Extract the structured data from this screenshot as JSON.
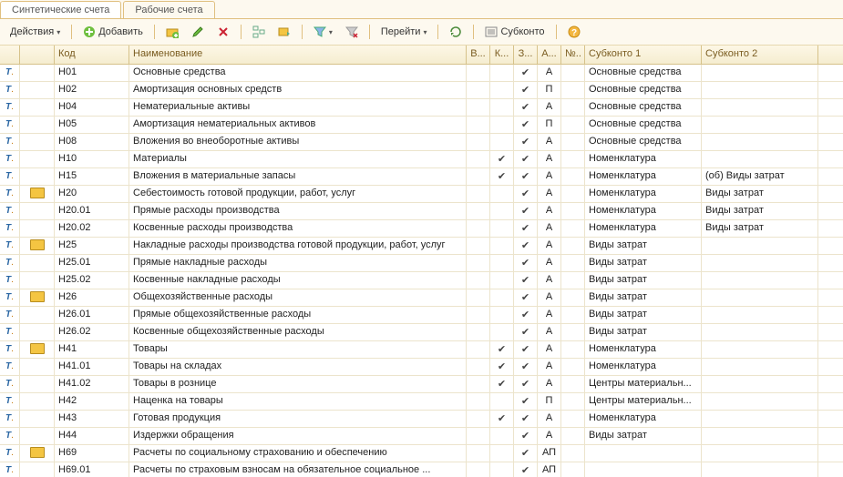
{
  "tabs": {
    "synthetic": "Синтетические счета",
    "working": "Рабочие счета"
  },
  "toolbar": {
    "actions": "Действия",
    "add": "Добавить",
    "go": "Перейти",
    "subkonto": "Субконто"
  },
  "columns": {
    "code": "Код",
    "name": "Наименование",
    "v": "В...",
    "k": "К...",
    "z": "З...",
    "a": "А...",
    "n": "№..",
    "s1": "Субконто 1",
    "s2": "Субконто 2"
  },
  "rows": [
    {
      "folder": false,
      "code": "Н01",
      "name": "Основные средства",
      "v": false,
      "k": false,
      "z": true,
      "a": "А",
      "n": "",
      "s1": "Основные средства",
      "s2": ""
    },
    {
      "folder": false,
      "code": "Н02",
      "name": "Амортизация основных средств",
      "v": false,
      "k": false,
      "z": true,
      "a": "П",
      "n": "",
      "s1": "Основные средства",
      "s2": ""
    },
    {
      "folder": false,
      "code": "Н04",
      "name": "Нематериальные активы",
      "v": false,
      "k": false,
      "z": true,
      "a": "А",
      "n": "",
      "s1": "Основные средства",
      "s2": ""
    },
    {
      "folder": false,
      "code": "Н05",
      "name": "Амортизация нематериальных активов",
      "v": false,
      "k": false,
      "z": true,
      "a": "П",
      "n": "",
      "s1": "Основные средства",
      "s2": ""
    },
    {
      "folder": false,
      "code": "Н08",
      "name": "Вложения во внеоборотные активы",
      "v": false,
      "k": false,
      "z": true,
      "a": "А",
      "n": "",
      "s1": "Основные средства",
      "s2": ""
    },
    {
      "folder": false,
      "code": "Н10",
      "name": "Материалы",
      "v": false,
      "k": true,
      "z": true,
      "a": "А",
      "n": "",
      "s1": "Номенклатура",
      "s2": ""
    },
    {
      "folder": false,
      "code": "Н15",
      "name": "Вложения в материальные запасы",
      "v": false,
      "k": true,
      "z": true,
      "a": "А",
      "n": "",
      "s1": "Номенклатура",
      "s2": "(об) Виды затрат"
    },
    {
      "folder": true,
      "code": "Н20",
      "name": "Себестоимость готовой продукции, работ, услуг",
      "v": false,
      "k": false,
      "z": true,
      "a": "А",
      "n": "",
      "s1": "Номенклатура",
      "s2": "Виды затрат"
    },
    {
      "folder": false,
      "code": "Н20.01",
      "name": "Прямые расходы производства",
      "v": false,
      "k": false,
      "z": true,
      "a": "А",
      "n": "",
      "s1": "Номенклатура",
      "s2": "Виды затрат"
    },
    {
      "folder": false,
      "code": "Н20.02",
      "name": "Косвенные расходы производства",
      "v": false,
      "k": false,
      "z": true,
      "a": "А",
      "n": "",
      "s1": "Номенклатура",
      "s2": "Виды затрат"
    },
    {
      "folder": true,
      "code": "Н25",
      "name": "Накладные расходы производства готовой продукции, работ, услуг",
      "v": false,
      "k": false,
      "z": true,
      "a": "А",
      "n": "",
      "s1": "Виды затрат",
      "s2": ""
    },
    {
      "folder": false,
      "code": "Н25.01",
      "name": "Прямые накладные расходы",
      "v": false,
      "k": false,
      "z": true,
      "a": "А",
      "n": "",
      "s1": "Виды затрат",
      "s2": ""
    },
    {
      "folder": false,
      "code": "Н25.02",
      "name": "Косвенные накладные расходы",
      "v": false,
      "k": false,
      "z": true,
      "a": "А",
      "n": "",
      "s1": "Виды затрат",
      "s2": ""
    },
    {
      "folder": true,
      "code": "Н26",
      "name": "Общехозяйственные расходы",
      "v": false,
      "k": false,
      "z": true,
      "a": "А",
      "n": "",
      "s1": "Виды затрат",
      "s2": ""
    },
    {
      "folder": false,
      "code": "Н26.01",
      "name": "Прямые общехозяйственные расходы",
      "v": false,
      "k": false,
      "z": true,
      "a": "А",
      "n": "",
      "s1": "Виды затрат",
      "s2": ""
    },
    {
      "folder": false,
      "code": "Н26.02",
      "name": "Косвенные общехозяйственные расходы",
      "v": false,
      "k": false,
      "z": true,
      "a": "А",
      "n": "",
      "s1": "Виды затрат",
      "s2": ""
    },
    {
      "folder": true,
      "code": "Н41",
      "name": "Товары",
      "v": false,
      "k": true,
      "z": true,
      "a": "А",
      "n": "",
      "s1": "Номенклатура",
      "s2": ""
    },
    {
      "folder": false,
      "code": "Н41.01",
      "name": "Товары на складах",
      "v": false,
      "k": true,
      "z": true,
      "a": "А",
      "n": "",
      "s1": "Номенклатура",
      "s2": ""
    },
    {
      "folder": false,
      "code": "Н41.02",
      "name": "Товары в рознице",
      "v": false,
      "k": true,
      "z": true,
      "a": "А",
      "n": "",
      "s1": "Центры материальн...",
      "s2": ""
    },
    {
      "folder": false,
      "code": "Н42",
      "name": "Наценка на товары",
      "v": false,
      "k": false,
      "z": true,
      "a": "П",
      "n": "",
      "s1": "Центры материальн...",
      "s2": ""
    },
    {
      "folder": false,
      "code": "Н43",
      "name": "Готовая продукция",
      "v": false,
      "k": true,
      "z": true,
      "a": "А",
      "n": "",
      "s1": "Номенклатура",
      "s2": ""
    },
    {
      "folder": false,
      "code": "Н44",
      "name": "Издержки обращения",
      "v": false,
      "k": false,
      "z": true,
      "a": "А",
      "n": "",
      "s1": "Виды затрат",
      "s2": ""
    },
    {
      "folder": true,
      "code": "Н69",
      "name": "Расчеты по социальному страхованию и обеспечению",
      "v": false,
      "k": false,
      "z": true,
      "a": "АП",
      "n": "",
      "s1": "",
      "s2": ""
    },
    {
      "folder": false,
      "code": "Н69.01",
      "name": "Расчеты по страховым взносам на обязательное социальное ...",
      "v": false,
      "k": false,
      "z": true,
      "a": "АП",
      "n": "",
      "s1": "",
      "s2": ""
    }
  ]
}
